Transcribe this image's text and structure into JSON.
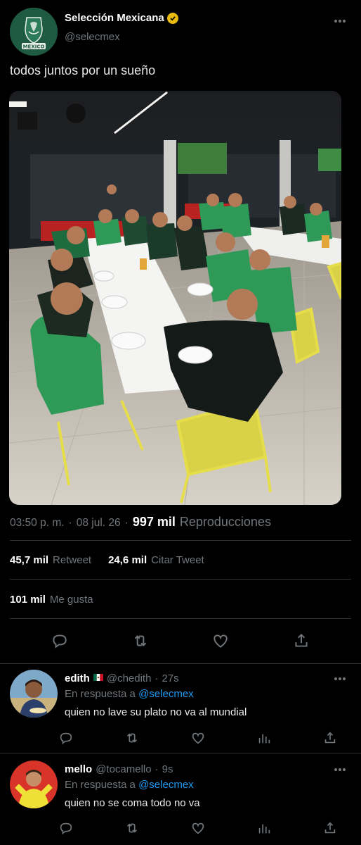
{
  "tweet": {
    "author": {
      "display_name": "Selección Mexicana",
      "handle": "@selecmex",
      "avatar_text": "MÉXICO"
    },
    "text": "todos juntos por un sueño",
    "time": "03:50 p. m.",
    "separator": "·",
    "date": "08 jul. 26",
    "views": "997 mil",
    "views_label": "Reproducciones",
    "retweets": "45,7 mil",
    "retweets_label": "Retweet",
    "quotes": "24,6 mil",
    "quotes_label": "Citar Tweet",
    "likes": "101 mil",
    "likes_label": "Me gusta"
  },
  "replies": [
    {
      "name": "edith",
      "handle": "@chedith",
      "separator": "·",
      "time": "27s",
      "reply_prefix": "En respuesta a",
      "mention": "@selecmex",
      "text": "quien no lave su plato no va al mundial"
    },
    {
      "name": "mello",
      "handle": "@tocamello",
      "separator": "·",
      "time": "9s",
      "reply_prefix": "En respuesta a",
      "mention": "@selecmex",
      "text": "quien no se coma todo no va"
    }
  ],
  "colors": {
    "background": "#000000",
    "text": "#e7e9ea",
    "secondary": "#71767b",
    "link": "#1d9bf0",
    "divider": "#2f3336",
    "verified": "#e8b90f"
  }
}
